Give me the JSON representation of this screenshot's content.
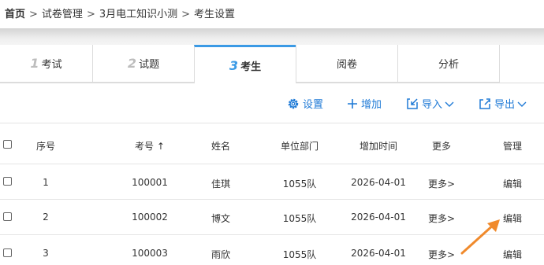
{
  "breadcrumb": {
    "home": "首页",
    "sep": ">",
    "items": [
      "试卷管理",
      "3月电工知识小测",
      "考生设置"
    ]
  },
  "tabs": [
    {
      "num": "1",
      "label": "考试"
    },
    {
      "num": "2",
      "label": "试题"
    },
    {
      "num": "3",
      "label": "考生"
    },
    {
      "label": "阅卷"
    },
    {
      "label": "分析"
    }
  ],
  "toolbar": {
    "settings": "设置",
    "add": "增加",
    "import": "导入",
    "export": "导出"
  },
  "table": {
    "headers": {
      "index": "序号",
      "id": "考号",
      "sort_arrow": "↑",
      "name": "姓名",
      "dept": "单位部门",
      "added": "增加时间",
      "more": "更多",
      "manage": "管理"
    },
    "rows": [
      {
        "index": "1",
        "id": "100001",
        "name": "佳琪",
        "dept": "1055队",
        "added": "2026-04-01",
        "more": "更多>",
        "manage": "编辑"
      },
      {
        "index": "2",
        "id": "100002",
        "name": "博文",
        "dept": "1055队",
        "added": "2026-04-01",
        "more": "更多>",
        "manage": "编辑"
      },
      {
        "index": "3",
        "id": "100003",
        "name": "雨欣",
        "dept": "1055队",
        "added": "2026-04-01",
        "more": "更多>",
        "manage": "编辑"
      }
    ]
  },
  "colors": {
    "accent": "#3b9ae5",
    "link": "#1f7ad6",
    "arrow": "#f08a2c"
  }
}
